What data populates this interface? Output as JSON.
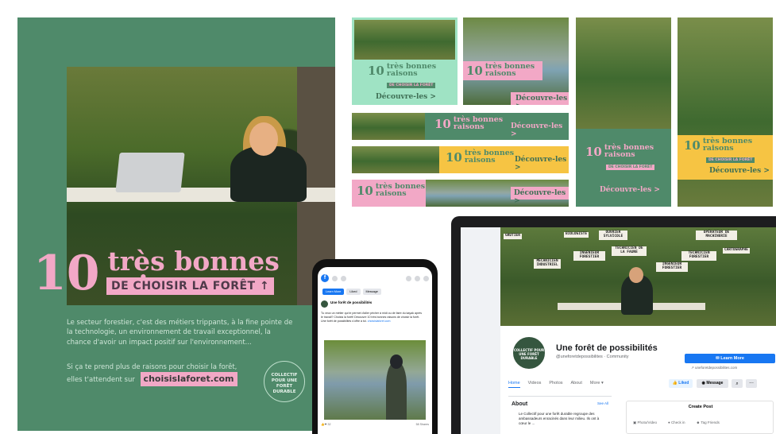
{
  "brand": {
    "number": "10",
    "words_line1": "très bonnes",
    "words_line2": "raisons",
    "tagline": "DE CHOISIR LA FORÊT",
    "cta": "Découvre-les >",
    "mini_tag": "DE CHOISIR LA FORÊT",
    "colors": {
      "green": "#4f8a6a",
      "pink": "#f2a8c6",
      "yellow": "#f6c443",
      "mint": "#9fe3c4"
    }
  },
  "poster": {
    "intro": "Le secteur forestier, c'est des métiers trippants, à la fine pointe de la technologie, un environnement de travail exceptionnel, la chance d'avoir un impact positif sur l'environnement...",
    "outro": "Si ça te prend plus de raisons pour choisir la forêt, elles t'attendent sur",
    "url": "choisislaforet.com",
    "collectif": "COLLECTIF POUR UNE FORÊT DURABLE"
  },
  "facebook_page": {
    "cover_signs": [
      "BIOLOGISTE",
      "OUVRIER SYLVICOLE",
      "OPÉRATEUR DE MACHINERIE",
      "INGÉNIEUR FORESTIER",
      "TECHNICIEN DE LA FAUNE",
      "TECHNICIEN FORESTIER",
      "CARTOGRAPHE",
      "MÉCANICIEN INDUSTRIEL",
      "INGÉNIEUR FORESTIER",
      "GRUTIER"
    ],
    "avatar_text": "COLLECTIF POUR UNE FORÊT DURABLE",
    "name": "Une forêt de possibilités",
    "handle": "@uneforetdepossibilites · Community",
    "learn_more": "Learn More",
    "website": "uneforetdepossibilites.com",
    "tabs": [
      "Home",
      "Videos",
      "Photos",
      "About",
      "More ▾"
    ],
    "liked": "Liked",
    "message": "Message",
    "about_title": "About",
    "see_all": "See All",
    "about_text": "Le Collectif pour une forêt durable regroupe des ambassadeurs enracinés dans leur milieu. Ils ont à cœur le ...",
    "create_post": "Create Post",
    "create_options": [
      "Photo/Video",
      "Check in",
      "Tag Friends"
    ]
  },
  "phone_post": {
    "page_name": "Une forêt de possibilités",
    "actions": [
      "Learn More",
      "Liked",
      "Message"
    ],
    "body": "Tu veux un métier qui te permet d'aller pêcher à midi ou de faire du kayak après le travail? Choisis la forêt! Découvre 10 très bonnes raisons de choisir la forêt. Une forêt de possibilités s'offre à toi.",
    "link": "choisislaforet.com",
    "footer_left": "👍❤ 32",
    "footer_right": "58 Shares"
  }
}
